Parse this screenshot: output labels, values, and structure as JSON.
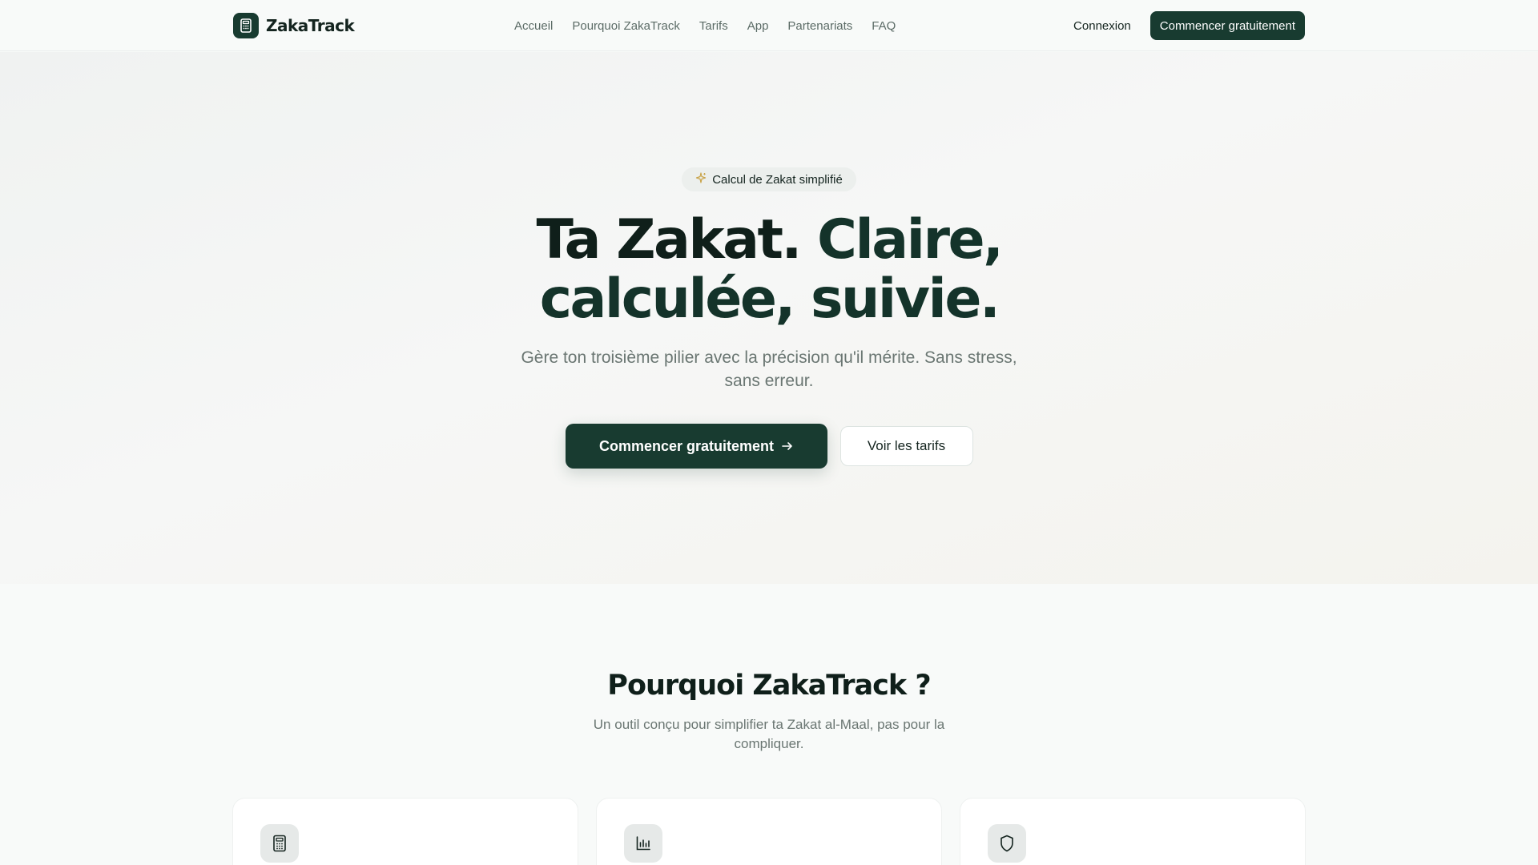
{
  "brand": {
    "name": "ZakaTrack",
    "logo_icon": "calculator-icon"
  },
  "nav": {
    "links": [
      "Accueil",
      "Pourquoi ZakaTrack",
      "Tarifs",
      "App",
      "Partenariats",
      "FAQ"
    ],
    "login": "Connexion",
    "cta": "Commencer gratuitement"
  },
  "hero": {
    "badge_icon": "sparkles-icon",
    "badge": "Calcul de Zakat simplifié",
    "title_part1": "Ta Zakat.",
    "title_part2": "Claire,",
    "title_line2": "calculée, suivie.",
    "subtitle": "Gère ton troisième pilier avec la précision qu'il mérite. Sans stress, sans erreur.",
    "primary_cta": "Commencer gratuitement",
    "primary_cta_icon": "arrow-right-icon",
    "secondary_cta": "Voir les tarifs"
  },
  "why": {
    "title": "Pourquoi ZakaTrack ?",
    "subtitle": "Un outil conçu pour simplifier ta Zakat al-Maal, pas pour la compliquer.",
    "cards": [
      {
        "icon": "calculator-icon"
      },
      {
        "icon": "bar-chart-icon"
      },
      {
        "icon": "shield-icon"
      }
    ]
  },
  "colors": {
    "primary": "#183b30",
    "heading": "#0f1f1a",
    "muted": "#6a7672",
    "badge_sparkle": "#c9a44a"
  }
}
